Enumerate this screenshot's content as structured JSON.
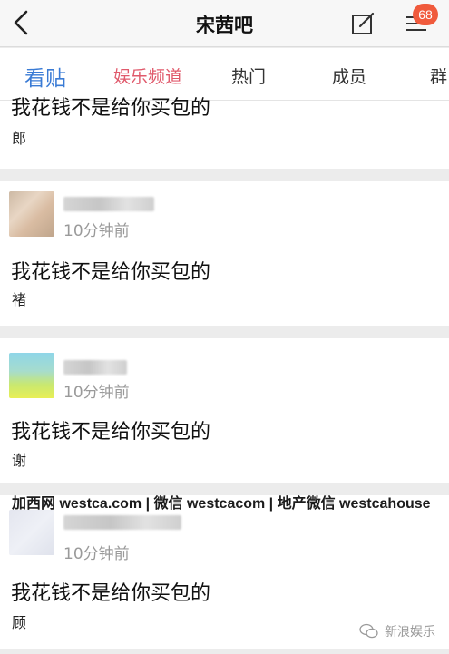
{
  "header": {
    "title": "宋茜吧",
    "badge_count": "68"
  },
  "tabs": [
    "看贴",
    "娱乐频道",
    "热门",
    "成员",
    "群"
  ],
  "first_post_partial": {
    "text": "我花钱不是给你买包的",
    "signature": "郎"
  },
  "posts": [
    {
      "time": "10分钟前",
      "text": "我花钱不是给你买包的",
      "signature": "褚"
    },
    {
      "time": "10分钟前",
      "text": "我花钱不是给你买包的",
      "signature": "谢"
    },
    {
      "time": "10分钟前",
      "text": "我花钱不是给你买包的",
      "signature": "顾"
    }
  ],
  "watermark": "加西网 westca.com | 微信 westcacom | 地产微信 westcahouse",
  "brand": "新浪娱乐",
  "colors": {
    "tab_active": "#3a7bd5",
    "tab_channel": "#e05a6c",
    "badge": "#f05a3c"
  },
  "icons": {
    "back": "back-chevron-icon",
    "edit": "edit-icon",
    "menu": "menu-icon",
    "brand": "wechat-icon"
  }
}
